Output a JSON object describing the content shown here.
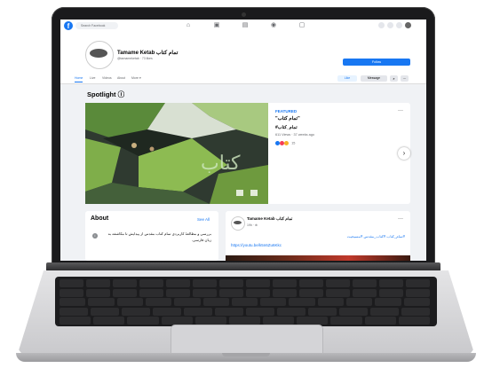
{
  "facebook": {
    "search_placeholder": "Search Facebook",
    "page": {
      "name": "Tamame Ketab تمام کتاب",
      "subtitle": "@tamameketab · 73 likes",
      "follow_label": "Follow"
    },
    "tabs": [
      "Home",
      "Live",
      "Videos",
      "About",
      "More ▾"
    ],
    "actions": {
      "like": "Like",
      "message": "Message"
    },
    "spotlight": {
      "title": "Spotlight ⓘ",
      "featured_label": "FEATURED",
      "post_title": "\"تمام کتاب\"",
      "post_tag": "#تمام_کتاب",
      "post_meta": "611 Views · 37 weeks ago",
      "reaction_count": "15"
    },
    "about": {
      "title": "About",
      "see_all": "See All",
      "text": "بررسی و مطالعهٔ کاربردی تمام کتاب مقدس از پیدایش تا مکاشفه به زبان فارسی."
    },
    "post": {
      "name": "Tamame Ketab تمام کتاب",
      "meta": "19h · ⊕",
      "tags": "#تمام_کتاب #کتاب_مقدس #مسیحیت",
      "link": "https://youtu.be/k5n6Zu6Kkc"
    }
  },
  "colors": {
    "accent": "#1877f2",
    "background": "#f0f2f5"
  }
}
